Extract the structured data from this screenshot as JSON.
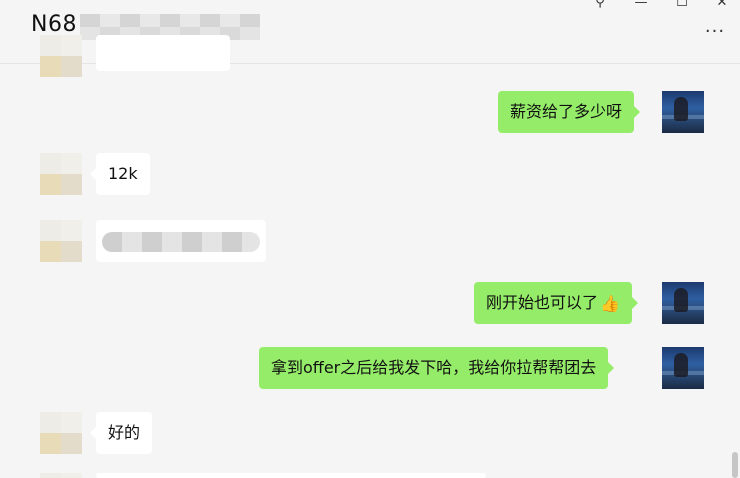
{
  "header": {
    "title_visible": "N68",
    "window_controls": {
      "pin_icon": "pin-icon",
      "minimize_icon": "minimize-icon",
      "maximize_icon": "maximize-icon",
      "close_icon": "close-icon",
      "pin_glyph": "⚲",
      "minimize_glyph": "—",
      "maximize_glyph": "☐",
      "close_glyph": "✕"
    },
    "more_glyph": "···"
  },
  "messages": [
    {
      "side": "self",
      "text": "薪资给了多少呀"
    },
    {
      "side": "other",
      "text": "12k"
    },
    {
      "side": "other",
      "text": "",
      "blurred": true
    },
    {
      "side": "self",
      "text": "刚开始也可以了",
      "emoji": "👍"
    },
    {
      "side": "self",
      "text": "拿到offer之后给我发下哈，我给你拉帮帮团去"
    },
    {
      "side": "other",
      "text": "好的"
    }
  ],
  "colors": {
    "self_bubble": "#95ec69",
    "other_bubble": "#ffffff",
    "background": "#f5f5f5"
  }
}
